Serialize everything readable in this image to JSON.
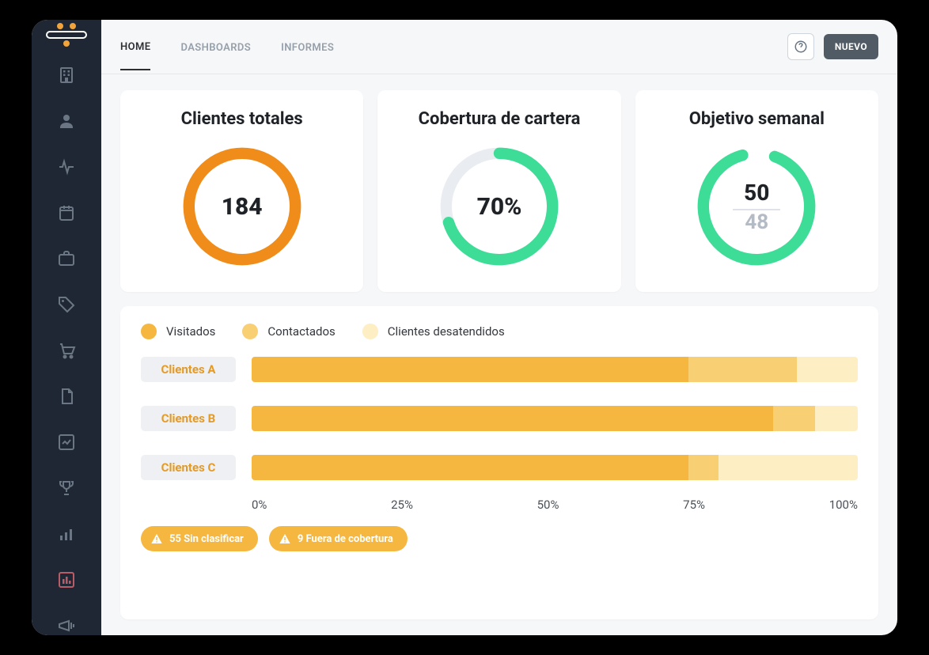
{
  "tabs": [
    "HOME",
    "DASHBOARDS",
    "INFORMES"
  ],
  "buttons": {
    "nuevo": "NUEVO"
  },
  "cards": {
    "totales": {
      "title": "Clientes totales",
      "value": "184"
    },
    "cobertura": {
      "title": "Cobertura de cartera",
      "percent": 70,
      "display": "70%"
    },
    "objetivo": {
      "title": "Objetivo semanal",
      "achieved": "50",
      "target": "48"
    }
  },
  "chart_data": {
    "type": "bar",
    "orientation": "horizontal_stacked",
    "xlabel": "",
    "ylabel": "",
    "x_range": [
      0,
      100
    ],
    "axis_ticks": [
      "0%",
      "25%",
      "50%",
      "75%",
      "100%"
    ],
    "categories": [
      "Clientes A",
      "Clientes B",
      "Clientes C"
    ],
    "series": [
      {
        "name": "Visitados",
        "color": "#f5b740",
        "swatch_style": "background:#f5b740",
        "values": [
          72,
          86,
          72
        ]
      },
      {
        "name": "Contactados",
        "color": "#f9cf74",
        "swatch_style": "background:#f9cf74",
        "values": [
          18,
          7,
          5
        ]
      },
      {
        "name": "Clientes desatendidos",
        "color": "#fdeec4",
        "swatch_style": "background:#fdeec4",
        "values": [
          10,
          7,
          23
        ]
      }
    ]
  },
  "warnings": [
    {
      "count": 55,
      "label": "55 Sin clasificar"
    },
    {
      "count": 9,
      "label": "9 Fuera de cobertura"
    }
  ],
  "colors": {
    "accent_orange": "#f08c1a",
    "accent_green": "#3ddc97",
    "bar_primary": "#f5b740"
  }
}
